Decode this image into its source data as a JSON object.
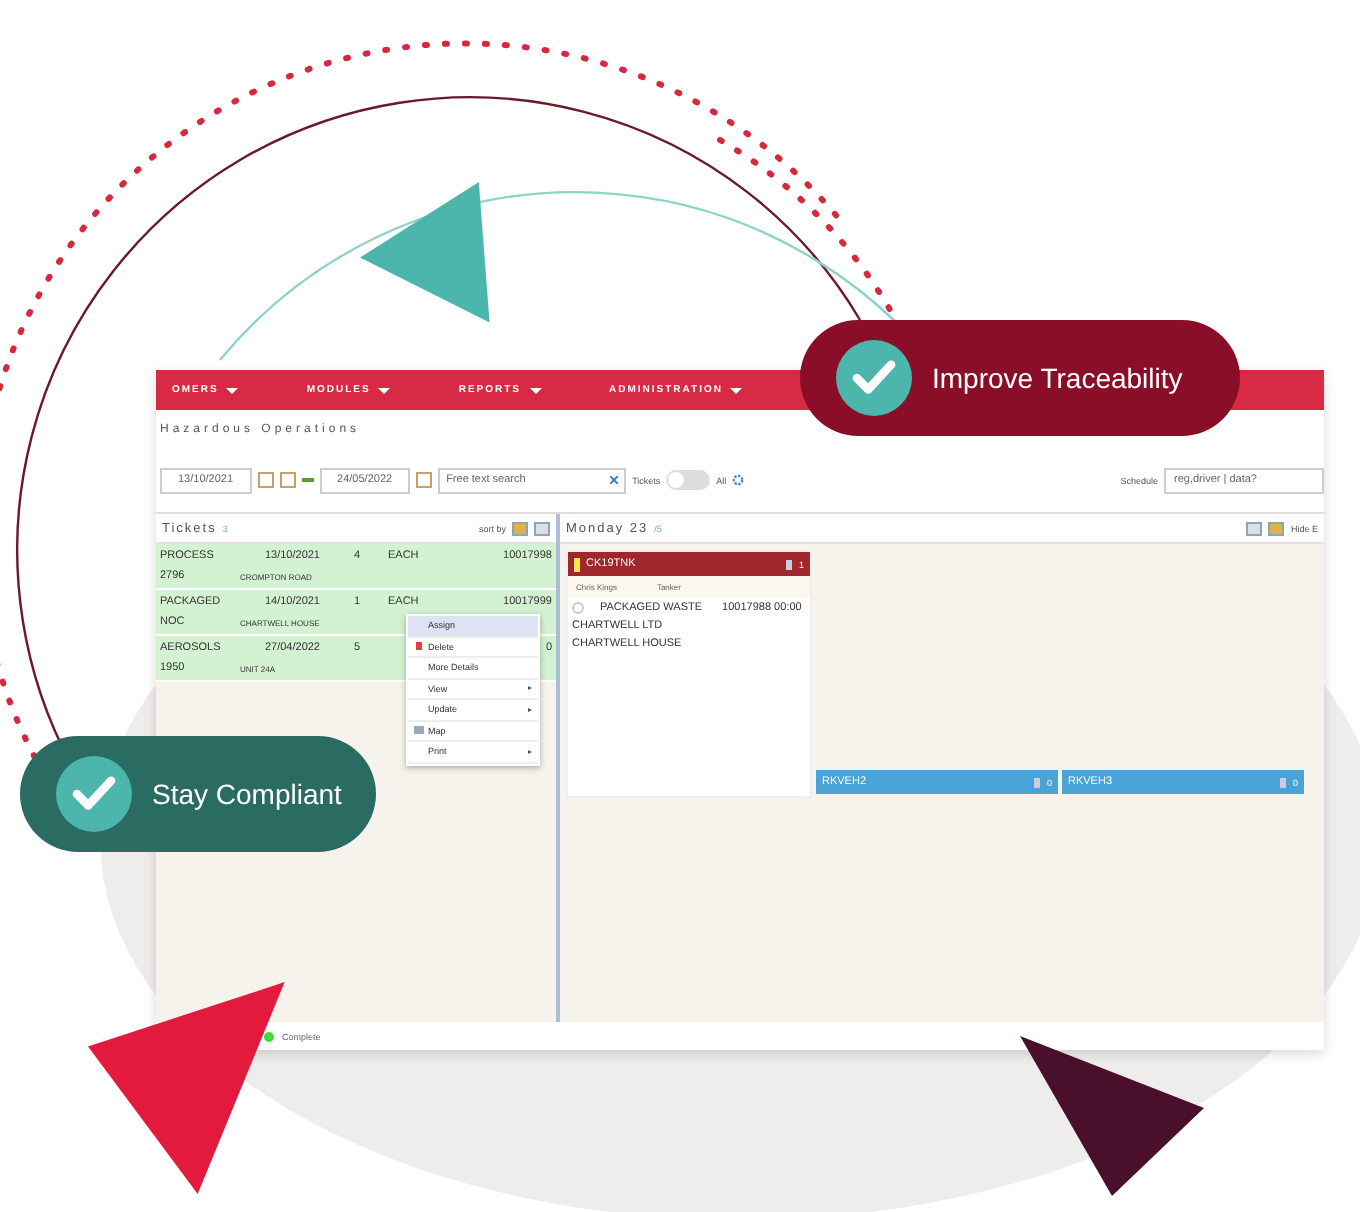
{
  "nav": [
    {
      "label": "OMERS"
    },
    {
      "label": "MODULES"
    },
    {
      "label": "REPORTS"
    },
    {
      "label": "ADMINISTRATION"
    }
  ],
  "page_title": "Hazardous Operations",
  "toolbar": {
    "date_from": "13/10/2021",
    "date_to": "24/05/2022",
    "search": {
      "placeholder": "Free text search"
    },
    "toggle": {
      "left_label": "Tickets",
      "right_label": "All",
      "on": false
    },
    "schedule_label": "Schedule",
    "schedule_value": "reg,driver | data?"
  },
  "tickets": {
    "title": "Tickets",
    "count": "3",
    "sort_label": "sort by",
    "rows": [
      {
        "line1": "PROCESS",
        "line2": "2796",
        "date": "13/10/2021",
        "qty": "4",
        "unit": "EACH",
        "ref": "10017998",
        "address": "CROMPTON ROAD"
      },
      {
        "line1": "PACKAGED",
        "line2": "NOC",
        "date": "14/10/2021",
        "qty": "1",
        "unit": "EACH",
        "ref": "10017999",
        "address": "CHARTWELL HOUSE"
      },
      {
        "line1": "AEROSOLS",
        "line2": "1950",
        "date": "27/04/2022",
        "qty": "5",
        "ref": "0",
        "address": "UNIT 24A"
      }
    ]
  },
  "context_menu": [
    {
      "label": "Assign",
      "kind": "plain",
      "selected": true,
      "submenu": false
    },
    {
      "label": "Delete",
      "kind": "delete",
      "selected": false,
      "submenu": false
    },
    {
      "label": "More Details",
      "kind": "plain",
      "selected": false,
      "submenu": false
    },
    {
      "label": "View",
      "kind": "plain",
      "selected": false,
      "submenu": true
    },
    {
      "label": "Update",
      "kind": "plain",
      "selected": false,
      "submenu": true
    },
    {
      "label": "Map",
      "kind": "map",
      "selected": false,
      "submenu": false
    },
    {
      "label": "Print",
      "kind": "plain",
      "selected": false,
      "submenu": true
    }
  ],
  "schedule": {
    "day": "Monday 23",
    "count": "/5",
    "hide_label": "Hide E",
    "vehicles": [
      {
        "reg": "CK19TNK",
        "color": "#a0282c",
        "count": "1",
        "driver": "Chris Kings",
        "type": "Tanker",
        "jobs": [
          {
            "selected": false,
            "title": "PACKAGED WASTE",
            "ref": "10017988 00:00",
            "lines": [
              "CHARTWELL LTD",
              "CHARTWELL HOUSE"
            ]
          }
        ]
      },
      {
        "reg": "RKVEH2",
        "color": "#4aa3d6",
        "count": "0"
      },
      {
        "reg": "RKVEH3",
        "color": "#4aa3d6",
        "count": "0"
      }
    ]
  },
  "status": {
    "label": "Complete",
    "color": "#3ddc3d"
  },
  "badges": [
    {
      "label": "Improve Traceability",
      "color": "#8b0e28"
    },
    {
      "label": "Stay Compliant",
      "color": "#2a6b62"
    }
  ]
}
